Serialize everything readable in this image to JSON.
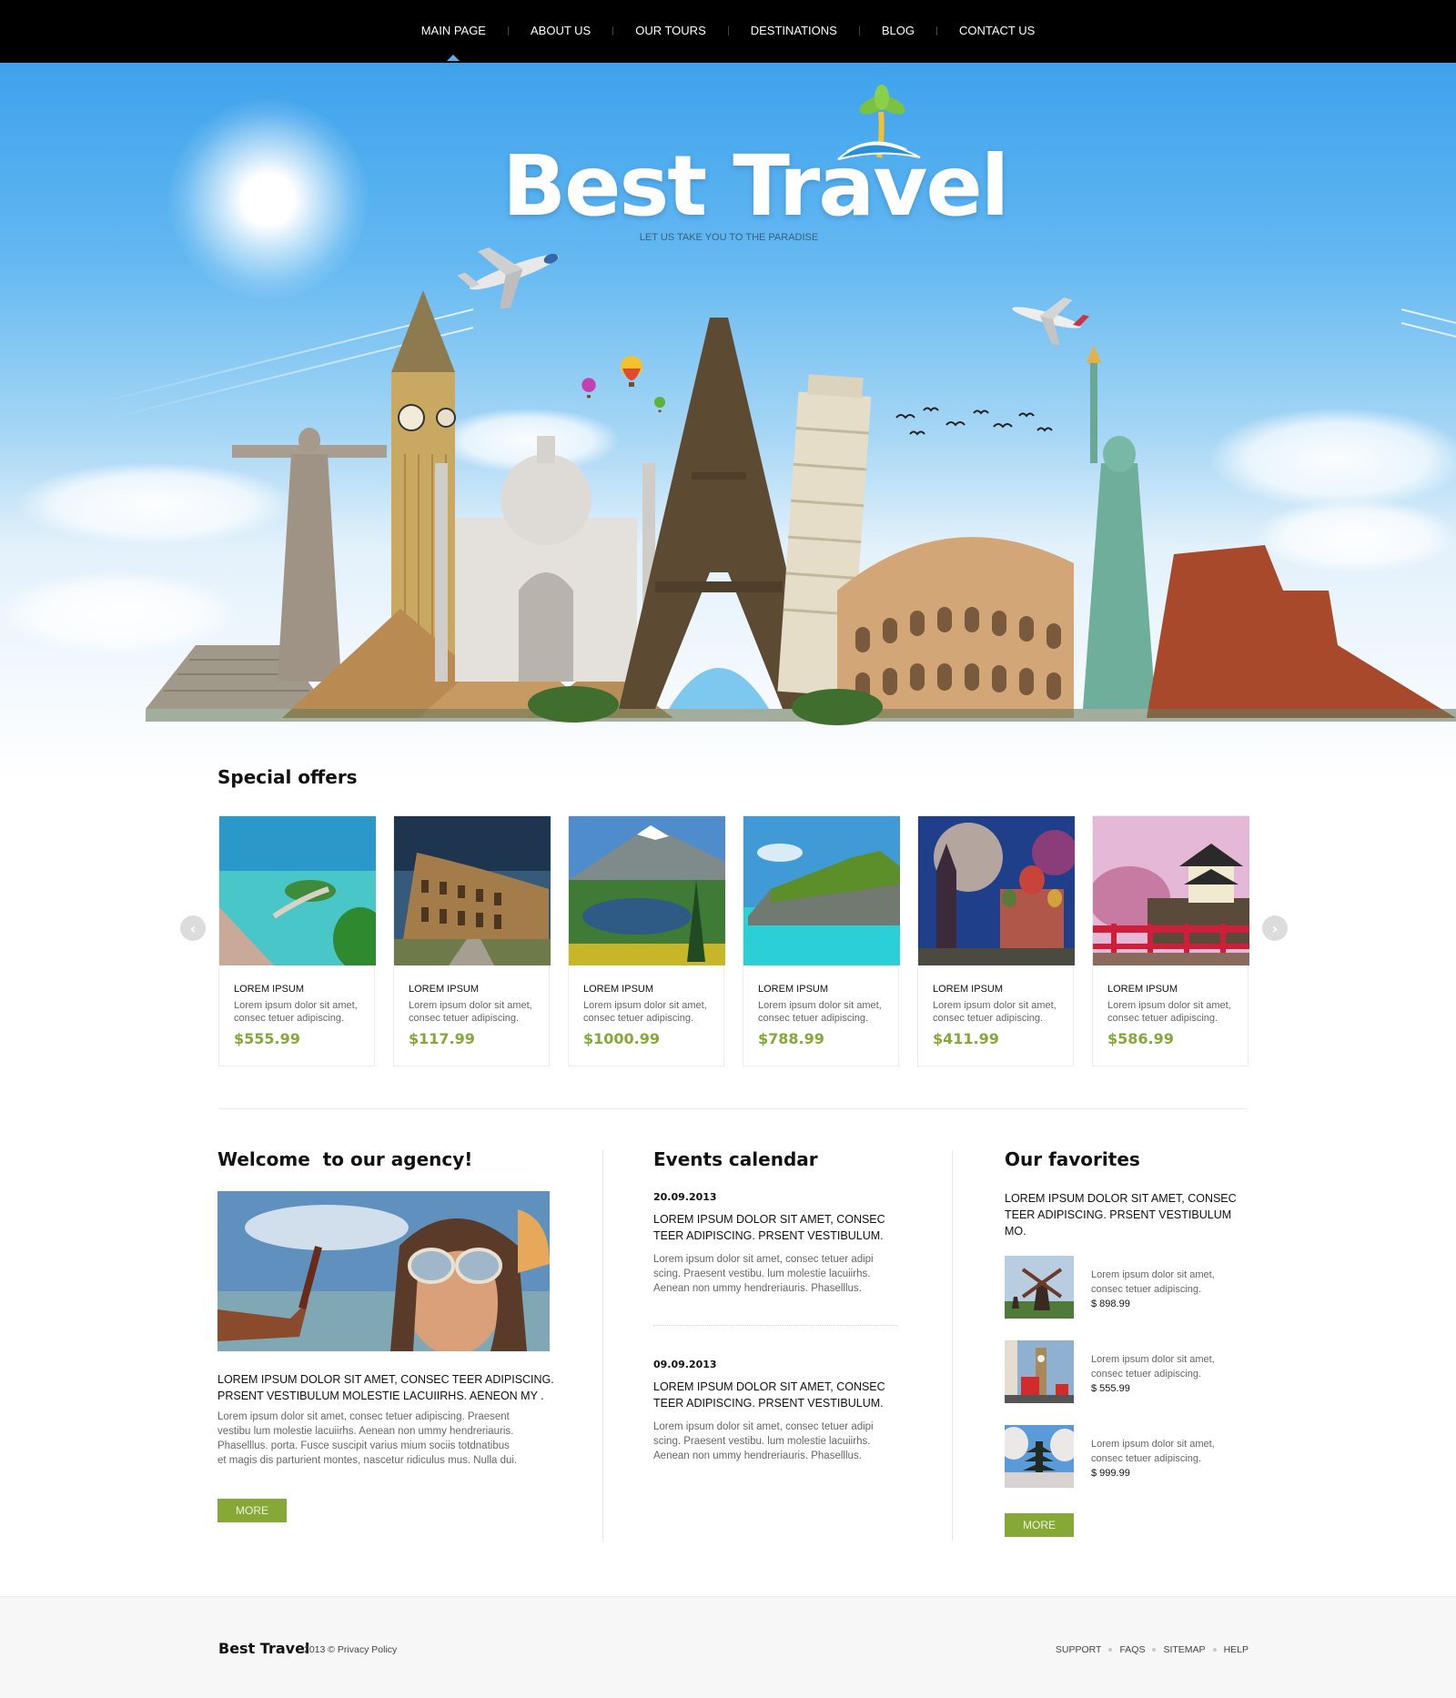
{
  "nav": {
    "items": [
      {
        "label": "MAIN PAGE",
        "active": true
      },
      {
        "label": "ABOUT US",
        "active": false
      },
      {
        "label": "OUR TOURS",
        "active": false
      },
      {
        "label": "DESTINATIONS",
        "active": false
      },
      {
        "label": "BLOG",
        "active": false
      },
      {
        "label": "CONTACT US",
        "active": false
      }
    ]
  },
  "hero": {
    "logo_text": "Best Travel",
    "tagline": "LET US TAKE YOU TO THE PARADISE",
    "image_description": "World landmarks collage: Christ the Redeemer, Big Ben, Chichen Itza, Pyramids, Taj Mahal, Eiffel Tower, Leaning Tower of Pisa, Colosseum, Statue of Liberty, Monument Valley"
  },
  "special_offers": {
    "title": "Special offers",
    "prev_icon": "chevron-left-icon",
    "next_icon": "chevron-right-icon",
    "items": [
      {
        "title": "LOREM IPSUM",
        "desc": "Lorem ipsum dolor sit amet, consec tetuer adipiscing.",
        "price": "$555.99",
        "image": "tropical-resort"
      },
      {
        "title": "LOREM IPSUM",
        "desc": "Lorem ipsum dolor sit amet, consec tetuer adipiscing.",
        "price": "$117.99",
        "image": "colosseum"
      },
      {
        "title": "LOREM IPSUM",
        "desc": "Lorem ipsum dolor sit amet, consec tetuer adipiscing.",
        "price": "$1000.99",
        "image": "mountain-lake"
      },
      {
        "title": "LOREM IPSUM",
        "desc": "Lorem ipsum dolor sit amet, consec tetuer adipiscing.",
        "price": "$788.99",
        "image": "rock-island"
      },
      {
        "title": "LOREM IPSUM",
        "desc": "Lorem ipsum dolor sit amet, consec tetuer adipiscing.",
        "price": "$411.99",
        "image": "moscow-fireworks"
      },
      {
        "title": "LOREM IPSUM",
        "desc": "Lorem ipsum dolor sit amet, consec tetuer adipiscing.",
        "price": "$586.99",
        "image": "japanese-castle"
      }
    ]
  },
  "welcome": {
    "title": "Welcome  to our agency!",
    "caps_line1": "LOREM IPSUM DOLOR SIT AMET, CONSEC TEER ADIPISCING.",
    "caps_line2": "PRSENT VESTIBULUM MOLESTIE LACUIIRHS. AENEON MY .",
    "para_lines": [
      "Lorem ipsum dolor sit amet, consec tetuer adipiscing. Praesent",
      "vestibu lum molestie lacuiirhs. Aenean non ummy hendreriauris.",
      "Phaselllus. porta. Fusce suscipit varius mium sociis totdnatibus",
      "et magis dis parturient montes, nascetur ridiculus mus. Nulla dui."
    ],
    "more_label": "MORE"
  },
  "events": {
    "title": "Events calendar",
    "items": [
      {
        "date": "20.09.2013",
        "caps_line1": "LOREM IPSUM DOLOR SIT AMET, CONSEC",
        "caps_line2": "TEER ADIPISCING. PRSENT VESTIBULUM.",
        "para_lines": [
          "Lorem ipsum dolor sit amet, consec tetuer adipi",
          "scing. Praesent vestibu.  lum molestie lacuiirhs.",
          "Aenean non ummy hendreriauris. Phaselllus."
        ]
      },
      {
        "date": "09.09.2013",
        "caps_line1": "LOREM IPSUM DOLOR SIT AMET, CONSEC",
        "caps_line2": "TEER ADIPISCING. PRSENT VESTIBULUM.",
        "para_lines": [
          "Lorem ipsum dolor sit amet, consec tetuer adipi",
          "scing. Praesent vestibu.  lum molestie lacuiirhs.",
          "Aenean non ummy hendreriauris. Phaselllus."
        ]
      }
    ]
  },
  "favorites": {
    "title": "Our favorites",
    "caps_line1": "LOREM IPSUM DOLOR SIT AMET, CONSEC",
    "caps_line2": "TEER ADIPISCING. PRSENT VESTIBULUM MO.",
    "items": [
      {
        "line1": "Lorem ipsum dolor sit amet,",
        "line2": "consec tetuer adipiscing.",
        "price": "$ 898.99",
        "image": "windmill"
      },
      {
        "line1": "Lorem ipsum dolor sit amet,",
        "line2": "consec tetuer adipiscing.",
        "price": "$ 555.99",
        "image": "big-ben-london"
      },
      {
        "line1": "Lorem ipsum dolor sit amet,",
        "line2": "consec tetuer adipiscing.",
        "price": "$ 999.99",
        "image": "pagoda-blossoms"
      }
    ],
    "more_label": "MORE"
  },
  "footer": {
    "brand": "Best Travel",
    "copyright": "2013 © Privacy Policy",
    "links": [
      "SUPPORT",
      "FAQS",
      "SITEMAP",
      "HELP"
    ]
  },
  "colors": {
    "accent_green": "#85a837",
    "nav_bg": "#000000",
    "sky_blue": "#3ea2ec",
    "footer_bg": "#f7f7f7"
  }
}
